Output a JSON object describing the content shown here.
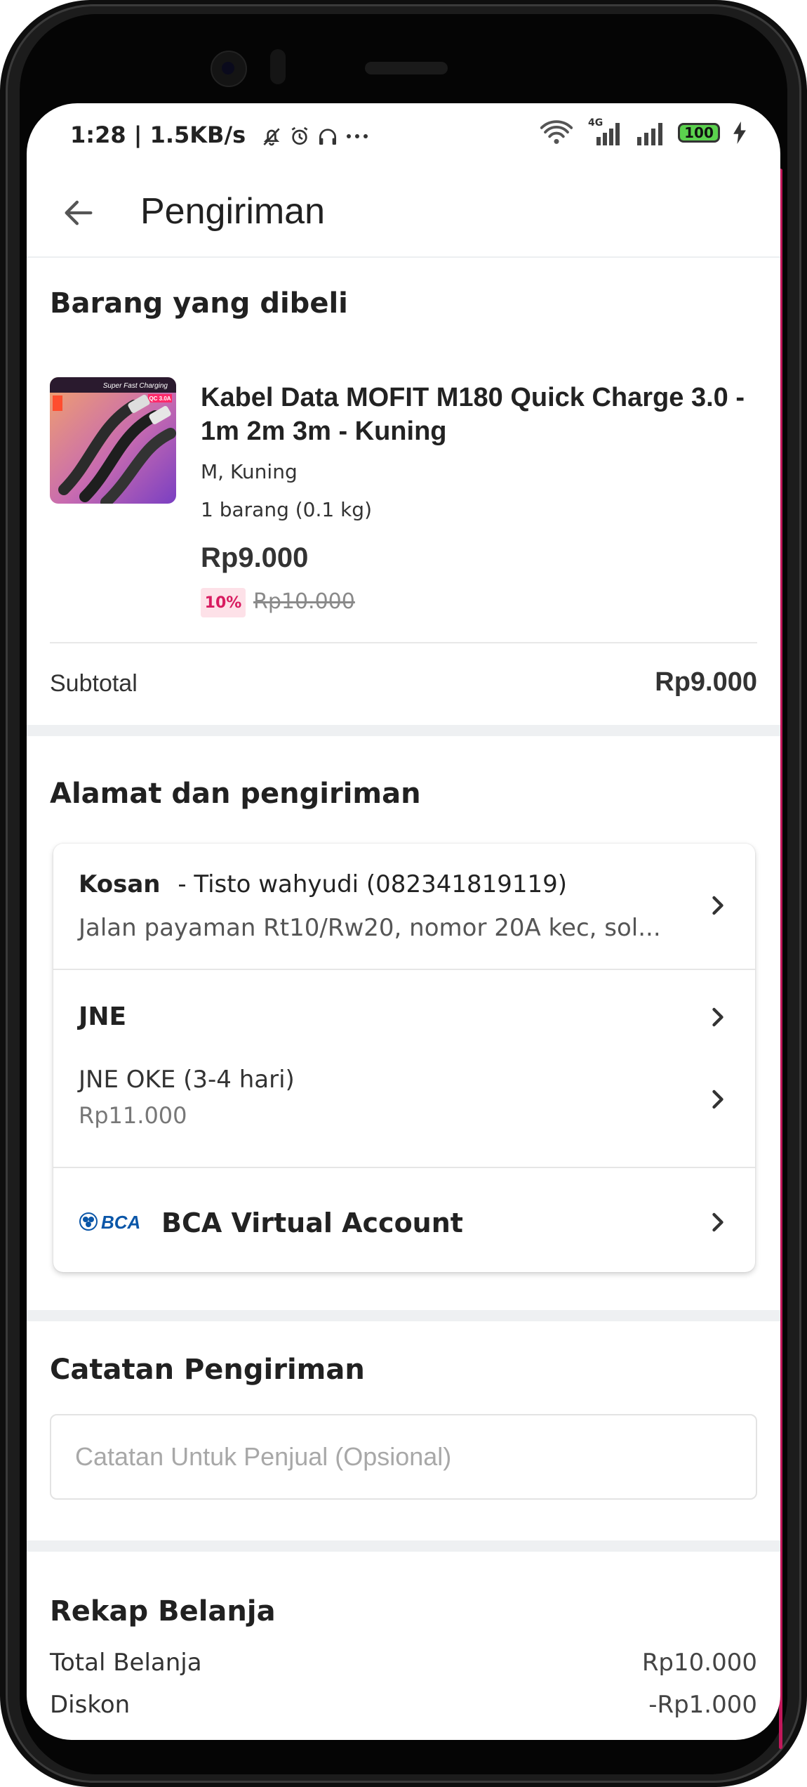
{
  "status": {
    "time": "1:28 | 1.5KB/s",
    "network": "4G",
    "battery": "100"
  },
  "header": {
    "title": "Pengiriman"
  },
  "purchase": {
    "section_title": "Barang yang dibeli",
    "product": {
      "thumb_top_text": "Super Fast Charging",
      "thumb_badge": "QC 3.0A",
      "name": "Kabel Data MOFIT M180 Quick Charge 3.0 - 1m 2m 3m - Kuning",
      "variant": "M, Kuning",
      "quantity": "1 barang (0.1 kg)",
      "price": "Rp9.000",
      "discount_badge": "10%",
      "original_price": "Rp10.000"
    },
    "subtotal_label": "Subtotal",
    "subtotal_value": "Rp9.000"
  },
  "shipping": {
    "section_title": "Alamat dan pengiriman",
    "address": {
      "label": "Kosan",
      "recipient": "- Tisto wahyudi (082341819119)",
      "street": "Jalan payaman Rt10/Rw20, nomor 20A kec, sol..."
    },
    "courier": "JNE",
    "service": "JNE OKE (3-4 hari)",
    "service_price": "Rp11.000",
    "payment_logo_text": "BCA",
    "payment": "BCA Virtual Account"
  },
  "notes": {
    "section_title": "Catatan Pengiriman",
    "placeholder": "Catatan Untuk Penjual (Opsional)",
    "value": ""
  },
  "recap": {
    "section_title": "Rekap Belanja",
    "rows": [
      {
        "label": "Total Belanja",
        "value": "Rp10.000"
      },
      {
        "label": "Diskon",
        "value": "-Rp1.000"
      }
    ]
  },
  "colors": {
    "accent": "#d81b60",
    "discount_bg": "#fde1e8",
    "divider_band": "#eef0f2",
    "battery": "#5bd14e",
    "bca_blue": "#0a56a8"
  }
}
